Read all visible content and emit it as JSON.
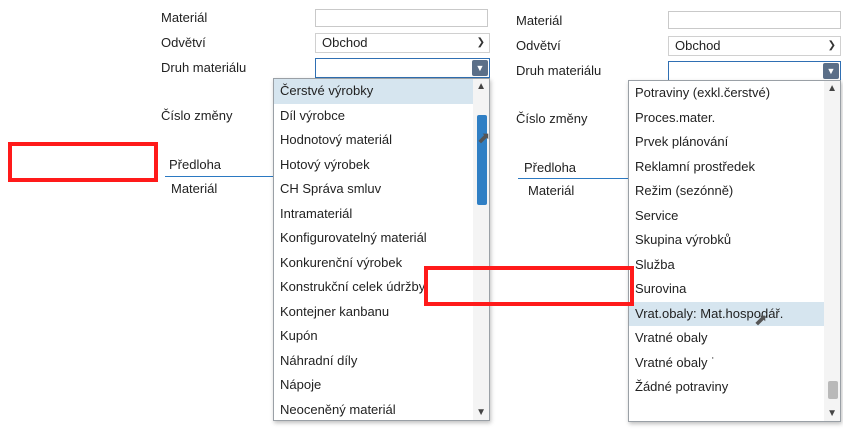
{
  "left": {
    "labels": {
      "material": "Materiál",
      "industry": "Odvětví",
      "type": "Druh materiálu",
      "change": "Číslo změny"
    },
    "industry_value": "Obchod",
    "tabs": {
      "template": "Předloha",
      "material": "Materiál"
    },
    "dropdown_items": [
      "Čerstvé výrobky",
      "Díl výrobce",
      "Hodnotový materiál",
      "Hotový výrobek",
      "CH Správa smluv",
      "Intramateriál",
      "Konfigurovatelný materiál",
      "Konkurenční výrobek",
      "Konstrukční celek údržby",
      "Kontejner kanbanu",
      "Kupón",
      "Náhradní díly",
      "Nápoje",
      "Neoceněný materiál"
    ],
    "selected_item": "Čerstvé výrobky"
  },
  "right": {
    "labels": {
      "material": "Materiál",
      "industry": "Odvětví",
      "type": "Druh materiálu",
      "change": "Číslo změny"
    },
    "industry_value": "Obchod",
    "tabs": {
      "template": "Předloha",
      "material": "Materiál"
    },
    "dropdown_items": [
      "Potraviny (exkl.čerstvé)",
      "Proces.mater.",
      "Prvek plánování",
      "Reklamní prostředek",
      "Režim (sezónně)",
      "Service",
      "Skupina výrobků",
      "Služba",
      "Surovina",
      "Vrat.obaly: Mat.hospodář.",
      "Vratné obaly",
      "Vratné obaly ˙",
      "Žádné potraviny"
    ],
    "hovered_item": "Vrat.obaly: Mat.hospodář."
  },
  "icons": {
    "chevron": "chevron-down-icon",
    "combo_button": "dropdown-button-icon",
    "cursor": "mouse-pointer-icon"
  },
  "colors": {
    "highlight_box": "#ff1a1a",
    "scroll_thumb_active": "#2f7fc4",
    "selection": "#d6e5ef"
  }
}
